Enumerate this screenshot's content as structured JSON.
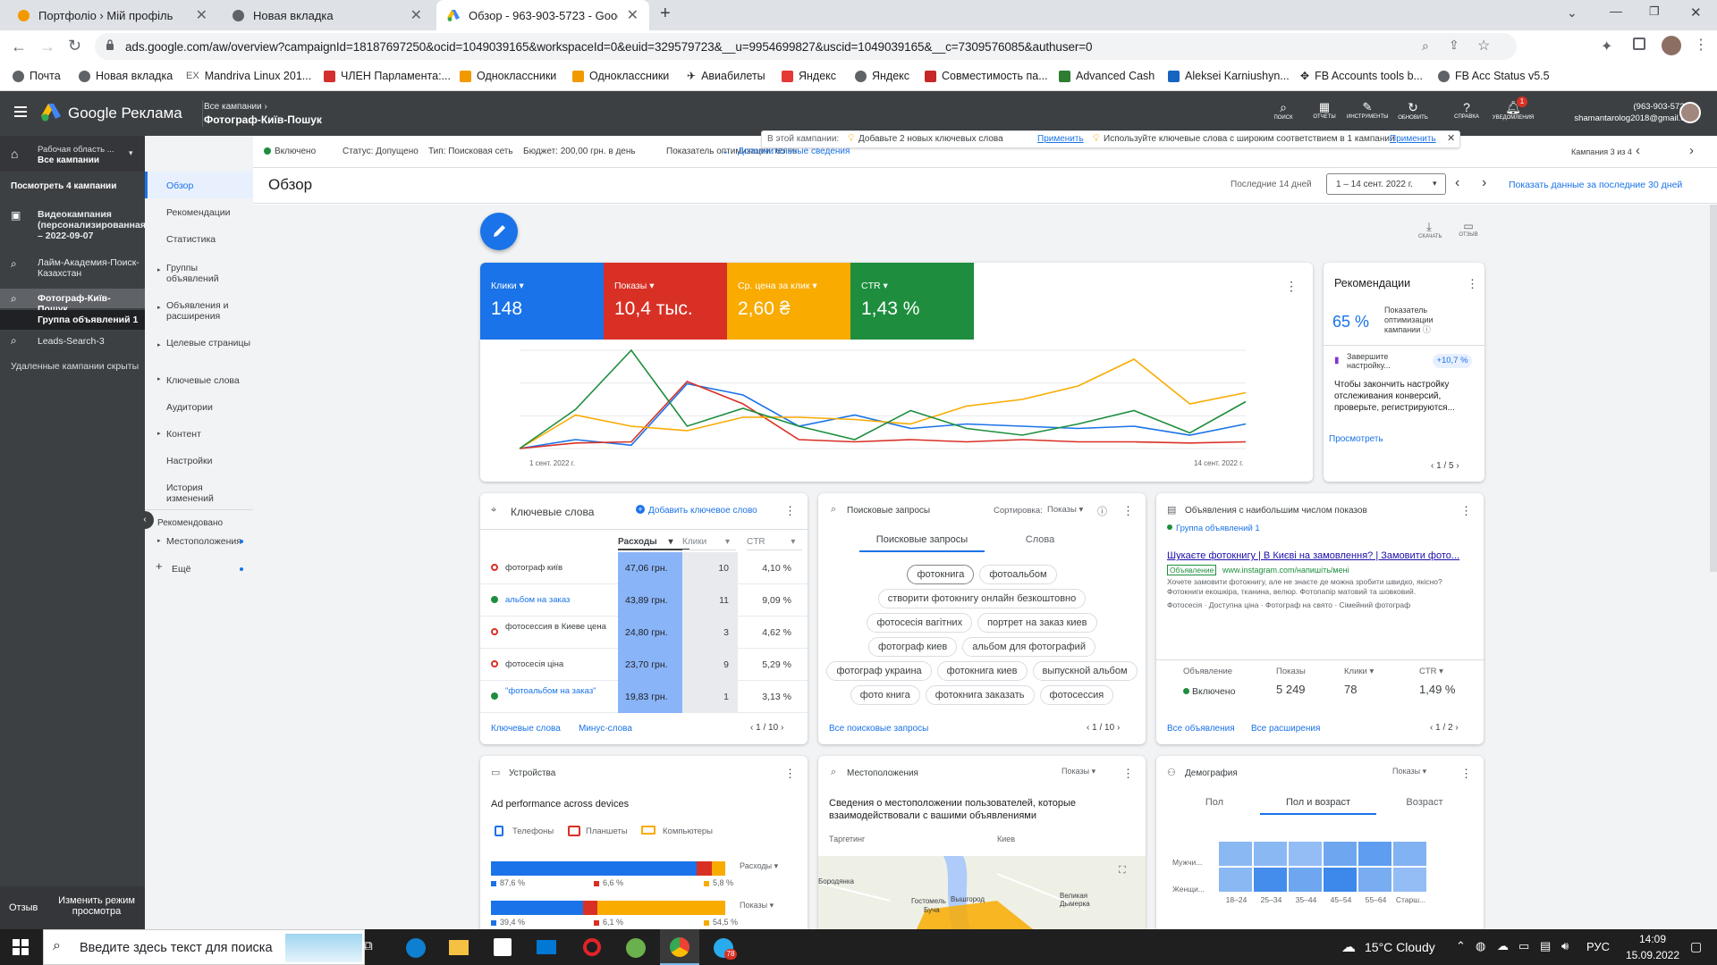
{
  "browser": {
    "tabs": [
      {
        "label": "Портфоліо › Мій профіль"
      },
      {
        "label": "Новая вкладка"
      },
      {
        "label": "Обзор - 963-903-5723 - Google"
      }
    ],
    "url": "ads.google.com/aw/overview?campaignId=18187697250&ocid=1049039165&workspaceId=0&euid=329579723&__u=9954699827&uscid=1049039165&__c=7309576085&authuser=0",
    "bookmarks": [
      "Почта",
      "Новая вкладка",
      "Mandriva Linux 201...",
      "ЧЛЕН Парламента:...",
      "Одноклассники",
      "Одноклассники",
      "Авиабилеты",
      "Яндекс",
      "Яндекс",
      "Совместимость па...",
      "Advanced Cash",
      "Aleksei Karniushyn...",
      "FB Accounts tools b...",
      "FB Acc Status v5.5"
    ]
  },
  "header": {
    "product": "Google Реклама",
    "crumb_top": "Все кампании",
    "crumb_main": "Фотограф-Київ-Пошук",
    "tools": [
      "ПОИСК",
      "ОТЧЕТЫ",
      "ИНСТРУМЕНТЫ",
      "ОБНОВИТЬ",
      "СПРАВКА",
      "УВЕДОМЛЕНИЯ"
    ],
    "notif_count": "1",
    "account_id": "(963-903-5723)",
    "account_email": "shamantarolog2018@gmail.c..."
  },
  "leftnav": {
    "workspace": [
      "Рабочая область ...",
      "Все кампании"
    ],
    "see_campaigns": "Посмотреть 4 кампании",
    "campaigns": [
      {
        "label": "Видеокампания (персонализированная) – 2022-09-07"
      },
      {
        "label": "Лайм-Академия-Поиск-Казахстан"
      },
      {
        "label": "Фотограф-Київ-Пошук"
      },
      {
        "label": "Группа объявлений 1"
      },
      {
        "label": "Leads-Search-3"
      }
    ],
    "removed": "Удаленные кампании скрыты",
    "feedback": "Отзыв",
    "change_view": "Изменить режим просмотра"
  },
  "subnav": {
    "items": [
      "Обзор",
      "Рекомендации",
      "Статистика",
      "Группы объявлений",
      "Объявления и расширения",
      "Целевые страницы",
      "Ключевые слова",
      "Аудитории",
      "Контент",
      "Настройки",
      "История изменений"
    ],
    "recommended": "Рекомендовано",
    "locations": "Местоположения",
    "more": "Ещё"
  },
  "statusbar": {
    "status_on": "Включено",
    "status": "Статус: Допущено",
    "type": "Тип: Поисковая сеть",
    "budget": "Бюджет: 200,00 грн. в день",
    "opt": "Показатель оптимизации: 65 %",
    "details": "Дополнительные сведения",
    "banner_prefix": "В этой кампании:",
    "banner1": "Добавьте 2 новых ключевых слова",
    "apply": "Применить",
    "banner2": "Используйте ключевые слова с широким соответствием в 1 кампании",
    "campaign_of": "Кампания 3 из 4"
  },
  "page": {
    "title": "Обзор",
    "period_label": "Последние 14 дней",
    "date_range": "1 – 14 сент. 2022 г.",
    "show30": "Показать данные за последние 30 дней",
    "download": "СКАЧАТЬ",
    "feedback": "ОТЗЫВ"
  },
  "metrics": [
    {
      "label": "Клики",
      "value": "148",
      "color": "#1a73e8"
    },
    {
      "label": "Показы",
      "value": "10,4 тыс.",
      "color": "#d93025"
    },
    {
      "label": "Ср. цена за клик",
      "value": "2,60 ₴",
      "color": "#f9ab00"
    },
    {
      "label": "CTR",
      "value": "1,43 %",
      "color": "#1e8e3e"
    }
  ],
  "chart_data": {
    "type": "line",
    "x_start": "1 сент. 2022 г.",
    "x_end": "14 сент. 2022 г.",
    "x": [
      1,
      2,
      3,
      4,
      5,
      6,
      7,
      8,
      9,
      10,
      11,
      12,
      13,
      14
    ],
    "grid": true,
    "legend": "none",
    "series": [
      {
        "values": [
          0,
          8,
          3,
          58,
          48,
          20,
          30,
          18,
          22,
          20,
          18,
          20,
          12,
          22
        ],
        "color": "#1a73e8"
      },
      {
        "values": [
          0,
          5,
          6,
          60,
          40,
          8,
          6,
          8,
          6,
          8,
          6,
          6,
          5,
          6
        ],
        "color": "#d93025"
      },
      {
        "values": [
          0,
          30,
          20,
          16,
          28,
          28,
          26,
          22,
          38,
          44,
          56,
          80,
          40,
          50
        ],
        "color": "#f9ab00"
      },
      {
        "values": [
          0,
          35,
          88,
          20,
          36,
          20,
          8,
          34,
          18,
          12,
          22,
          34,
          14,
          42
        ],
        "color": "#1e8e3e"
      }
    ]
  },
  "recommendations": {
    "title": "Рекомендации",
    "score": "65 %",
    "score_label": "Показатель оптимизации кампании",
    "item_label": "Завершите настройку...",
    "uplift": "+10,7 %",
    "text": "Чтобы закончить настройку отслеживания конверсий, проверьте, регистрируются...",
    "view": "Просмотреть",
    "pager": "1 / 5"
  },
  "keywords": {
    "title": "Ключевые слова",
    "add": "Добавить ключевое слово",
    "cols": [
      "Расходы",
      "Клики",
      "CTR"
    ],
    "rows": [
      {
        "kw": "фотограф київ",
        "cost": "47,06 грн.",
        "clicks": "10",
        "ctr": "4,10 %",
        "status": "red",
        "link": false
      },
      {
        "kw": "альбом на заказ",
        "cost": "43,89 грн.",
        "clicks": "11",
        "ctr": "9,09 %",
        "status": "green",
        "link": true
      },
      {
        "kw": "фотосессия в Киеве цена",
        "cost": "24,80 грн.",
        "clicks": "3",
        "ctr": "4,62 %",
        "status": "red",
        "link": false
      },
      {
        "kw": "фотосесія ціна",
        "cost": "23,70 грн.",
        "clicks": "9",
        "ctr": "5,29 %",
        "status": "red",
        "link": false
      },
      {
        "kw": "\"фотоальбом на заказ\"",
        "cost": "19,83 грн.",
        "clicks": "1",
        "ctr": "3,13 %",
        "status": "green",
        "link": true
      }
    ],
    "footer_links": [
      "Ключевые слова",
      "Минус-слова"
    ],
    "pager": "1 / 10"
  },
  "search_terms": {
    "title": "Поисковые запросы",
    "sort_label": "Сортировка:",
    "sort_value": "Показы",
    "tabs": [
      "Поисковые запросы",
      "Слова"
    ],
    "chips": [
      "фотокнига",
      "фотоальбом",
      "створити фотокнигу онлайн безкоштовно",
      "фотосесія вагітних",
      "портрет на заказ киев",
      "фотограф киев",
      "альбом для фотографий",
      "фотограф украина",
      "фотокнига киев",
      "выпускной альбом",
      "фото книга",
      "фотокнига заказать",
      "фотосессия"
    ],
    "all": "Все поисковые запросы",
    "pager": "1 / 10"
  },
  "ads": {
    "title": "Объявления с наибольшим числом показов",
    "group": "Группа объявлений 1",
    "headline": "Шукаєте фотокнигу | В Києві на замовлення? | Замовити фото...",
    "ad_badge": "Объявление",
    "display_url": "www.instagram.com/напишіть/мені",
    "desc": "Хочете замовити фотокнигу, але не знаєте де можна зробити швидко, якісно? Фотокниги екошкіра, тканина, велюр. Фотопапір матовий та шовковий.",
    "sitelinks": "Фотосесія · Доступна ціна · Фотограф на свято · Сімейний фотограф",
    "cols": [
      "Объявление",
      "Показы",
      "Клики",
      "CTR"
    ],
    "status": "Включено",
    "impr": "5 249",
    "clicks": "78",
    "ctr": "1,49 %",
    "links": [
      "Все объявления",
      "Все расширения"
    ],
    "pager": "1 / 2"
  },
  "devices": {
    "title": "Устройства",
    "subtitle": "Ad performance across devices",
    "legend": [
      "Телефоны",
      "Планшеты",
      "Компьютеры"
    ],
    "bars": [
      {
        "metric": "Расходы",
        "values": [
          87.6,
          6.6,
          5.8
        ],
        "labels": [
          "87,6 %",
          "6,6 %",
          "5,8 %"
        ]
      },
      {
        "metric": "Показы",
        "values": [
          39.4,
          6.1,
          54.5
        ],
        "labels": [
          "39,4 %",
          "6,1 %",
          "54,5 %"
        ]
      }
    ]
  },
  "locations": {
    "title": "Местоположения",
    "metric": "Показы",
    "desc": "Сведения о местоположении пользователей, которые взаимодействовали с вашими объявлениями",
    "targeting_label": "Таргетинг",
    "targeting_value": "Киев",
    "map_labels": [
      "Бородянка",
      "Гостомель",
      "Буча",
      "Вышгород",
      "Великая Дымерка"
    ]
  },
  "demographics": {
    "title": "Демография",
    "metric": "Показы",
    "tabs": [
      "Пол",
      "Пол и возраст",
      "Возраст"
    ],
    "rows": [
      "Мужчи...",
      "Женщи..."
    ],
    "cols": [
      "18–24",
      "25–34",
      "35–44",
      "45–54",
      "55–64",
      "Старш..."
    ],
    "heat": [
      [
        0.35,
        0.35,
        0.3,
        0.5,
        0.6,
        0.4
      ],
      [
        0.35,
        0.75,
        0.5,
        0.8,
        0.45,
        0.3
      ]
    ]
  },
  "taskbar": {
    "search_placeholder": "Введите здесь текст для поиска",
    "weather": "15°C  Cloudy",
    "lang": "РУС",
    "time": "14:09",
    "date": "15.09.2022",
    "telegram_badge": "78"
  }
}
